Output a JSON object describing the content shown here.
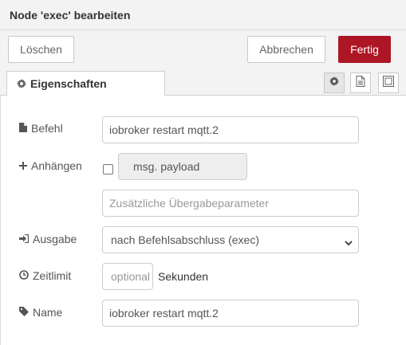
{
  "dialog": {
    "title": "Node 'exec' bearbeiten"
  },
  "buttons": {
    "delete": "Löschen",
    "cancel": "Abbrechen",
    "done": "Fertig"
  },
  "tabs": {
    "properties": "Eigenschaften"
  },
  "form": {
    "command": {
      "label": "Befehl",
      "value": "iobroker restart mqtt.2"
    },
    "append": {
      "label": "Anhängen",
      "checked": false,
      "payload": "msg. payload",
      "extra_placeholder": "Zusätzliche Übergabeparameter"
    },
    "output": {
      "label": "Ausgabe",
      "selected": "nach Befehlsabschluss (exec)"
    },
    "timeout": {
      "label": "Zeitlimit",
      "placeholder": "optional",
      "unit": "Sekunden"
    },
    "name": {
      "label": "Name",
      "value": "iobroker restart mqtt.2"
    }
  },
  "colors": {
    "primary": "#ad1625"
  },
  "icons": {
    "tab": "gear-icon",
    "command": "file-icon",
    "append": "plus-icon",
    "output": "sign-in-icon",
    "timeout": "clock-icon",
    "name": "tag-icon",
    "tool_settings": "gear-icon",
    "tool_description": "document-icon",
    "tool_appearance": "layout-icon"
  }
}
